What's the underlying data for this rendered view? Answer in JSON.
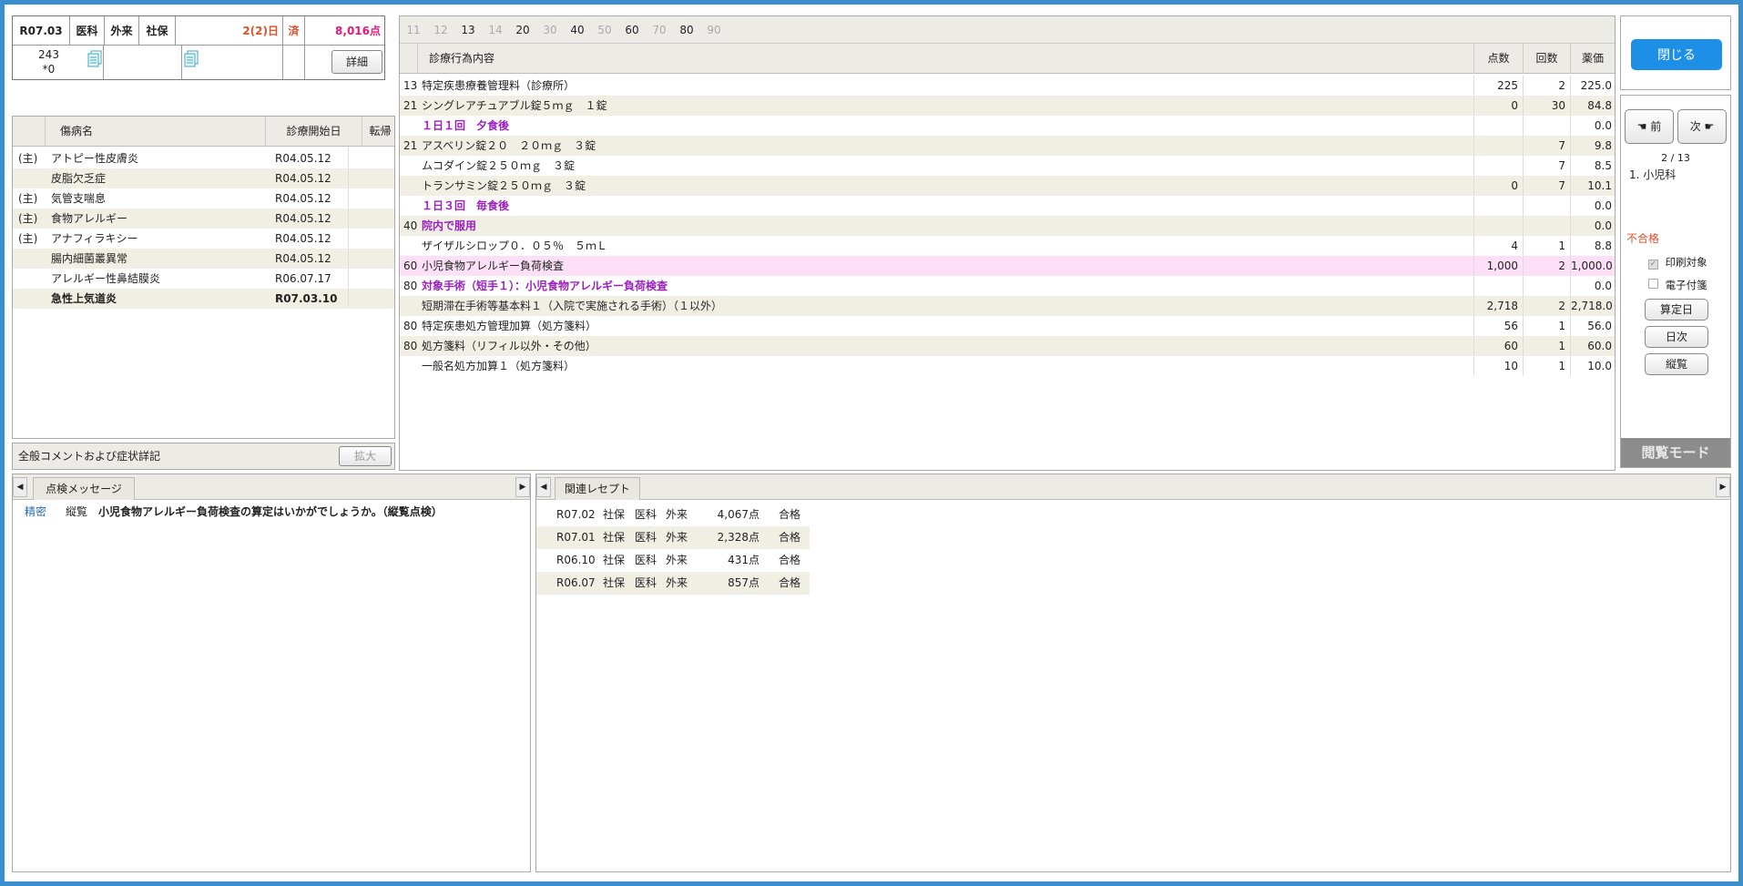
{
  "summary": {
    "date": "R07.03",
    "kind1": "医科",
    "kind2": "外来",
    "kind3": "社保",
    "days": "2(2)日",
    "done": "済",
    "points": "8,016点",
    "count1": "243",
    "count2": "*0",
    "detail_btn": "詳細"
  },
  "disease": {
    "headers": [
      "傷病名",
      "診療開始日",
      "転帰"
    ],
    "rows": [
      {
        "main": "(主)",
        "name": "アトピー性皮膚炎",
        "date": "R04.05.12",
        "bold": false
      },
      {
        "main": "",
        "name": "皮脂欠乏症",
        "date": "R04.05.12",
        "bold": false
      },
      {
        "main": "(主)",
        "name": "気管支喘息",
        "date": "R04.05.12",
        "bold": false
      },
      {
        "main": "(主)",
        "name": "食物アレルギー",
        "date": "R04.05.12",
        "bold": false
      },
      {
        "main": "(主)",
        "name": "アナフィラキシー",
        "date": "R04.05.12",
        "bold": false
      },
      {
        "main": "",
        "name": "腸内細菌叢異常",
        "date": "R04.05.12",
        "bold": false
      },
      {
        "main": "",
        "name": "アレルギー性鼻結膜炎",
        "date": "R06.07.17",
        "bold": false
      },
      {
        "main": "",
        "name": "急性上気道炎",
        "date": "R07.03.10",
        "bold": true
      }
    ]
  },
  "comment": {
    "label": "全般コメントおよび症状詳記",
    "expand": "拡大"
  },
  "codes": [
    "11",
    "12",
    "13",
    "14",
    "20",
    "30",
    "40",
    "50",
    "60",
    "70",
    "80",
    "90"
  ],
  "codes_active": [
    false,
    false,
    true,
    false,
    true,
    false,
    true,
    false,
    true,
    false,
    true,
    false
  ],
  "treatment": {
    "headers": [
      "診療行為内容",
      "点数",
      "回数",
      "薬価"
    ],
    "rows": [
      {
        "code": "13",
        "name": "特定疾患療養管理料（診療所）",
        "pts": "225",
        "cnt": "2",
        "price": "225.0",
        "style": "n"
      },
      {
        "code": "21",
        "name": "シングレアチュアブル錠５ｍｇ　１錠",
        "pts": "0",
        "cnt": "30",
        "price": "84.8",
        "style": "n"
      },
      {
        "code": "",
        "name": "１日１回　夕食後",
        "pts": "",
        "cnt": "",
        "price": "0.0",
        "style": "p"
      },
      {
        "code": "21",
        "name": "アスベリン錠２０　２０ｍｇ　３錠",
        "pts": "",
        "cnt": "7",
        "price": "9.8",
        "style": "n"
      },
      {
        "code": "",
        "name": "ムコダイン錠２５０ｍｇ　３錠",
        "pts": "",
        "cnt": "7",
        "price": "8.5",
        "style": "n"
      },
      {
        "code": "",
        "name": "トランサミン錠２５０ｍｇ　３錠",
        "pts": "0",
        "cnt": "7",
        "price": "10.1",
        "style": "n"
      },
      {
        "code": "",
        "name": "１日３回　毎食後",
        "pts": "",
        "cnt": "",
        "price": "0.0",
        "style": "p"
      },
      {
        "code": "40",
        "name": "院内で服用",
        "pts": "",
        "cnt": "",
        "price": "0.0",
        "style": "p"
      },
      {
        "code": "",
        "name": "ザイザルシロップ０．０５％　５ｍＬ",
        "pts": "4",
        "cnt": "1",
        "price": "8.8",
        "style": "n"
      },
      {
        "code": "60",
        "name": "小児食物アレルギー負荷検査",
        "pts": "1,000",
        "cnt": "2",
        "price": "1,000.0",
        "style": "h"
      },
      {
        "code": "80",
        "name": "対象手術（短手１）：小児食物アレルギー負荷検査",
        "pts": "",
        "cnt": "",
        "price": "0.0",
        "style": "p"
      },
      {
        "code": "",
        "name": "短期滞在手術等基本料１（入院で実施される手術）（１以外）",
        "pts": "2,718",
        "cnt": "2",
        "price": "2,718.0",
        "style": "n"
      },
      {
        "code": "80",
        "name": "特定疾患処方管理加算（処方箋料）",
        "pts": "56",
        "cnt": "1",
        "price": "56.0",
        "style": "n"
      },
      {
        "code": "80",
        "name": "処方箋料（リフィル以外・その他）",
        "pts": "60",
        "cnt": "1",
        "price": "60.0",
        "style": "n"
      },
      {
        "code": "",
        "name": "一般名処方加算１（処方箋料）",
        "pts": "10",
        "cnt": "1",
        "price": "10.0",
        "style": "n"
      }
    ]
  },
  "side": {
    "close": "閉じる",
    "prev": "前",
    "next": "次",
    "page": "2 / 13",
    "dept": "1. 小児科",
    "fail": "不合格",
    "print": "印刷対象",
    "elec": "電子付箋",
    "calc": "算定日",
    "daily": "日次",
    "vertical": "縦覧",
    "mode": "閲覧モード"
  },
  "check": {
    "tab": "点検メッセージ",
    "items": [
      {
        "level": "精密",
        "type": "縦覧",
        "msg": "小児食物アレルギー負荷検査の算定はいかがでしょうか。（縦覧点検）"
      }
    ]
  },
  "related": {
    "tab": "関連レセプト",
    "rows": [
      {
        "date": "R07.02",
        "ins": "社保",
        "kind": "医科",
        "type": "外来",
        "pts": "4,067点",
        "status": "合格"
      },
      {
        "date": "R07.01",
        "ins": "社保",
        "kind": "医科",
        "type": "外来",
        "pts": "2,328点",
        "status": "合格"
      },
      {
        "date": "R06.10",
        "ins": "社保",
        "kind": "医科",
        "type": "外来",
        "pts": "431点",
        "status": "合格"
      },
      {
        "date": "R06.07",
        "ins": "社保",
        "kind": "医科",
        "type": "外来",
        "pts": "857点",
        "status": "合格"
      }
    ]
  },
  "colors": {
    "border": "#3a8fcf",
    "purple": "#9b1fc0",
    "pink_row": "#fde0f7",
    "red": "#e0502a",
    "pink_text": "#e0187a",
    "close_btn": "#1e8fe6"
  }
}
